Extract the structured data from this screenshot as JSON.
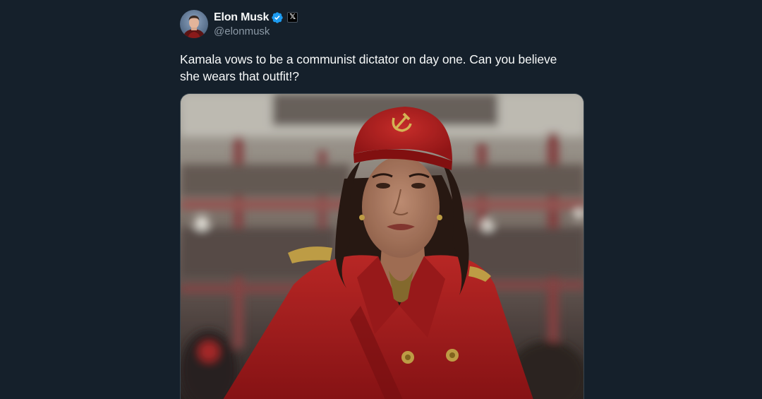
{
  "tweet": {
    "author": {
      "display_name": "Elon Musk",
      "handle": "@elonmusk",
      "verified_icon": "verified-badge-icon",
      "affiliate_icon": "x-logo-icon",
      "affiliate_label": "𝕏"
    },
    "text": "Kamala vows to be a communist dictator on day one. Can you believe she wears that outfit!?",
    "media": {
      "alt": "Image of a woman in a red military-style coat and red cap with hammer and sickle emblem"
    }
  },
  "colors": {
    "background": "#15202b",
    "text_primary": "#f7f9f9",
    "text_secondary": "#8b98a5",
    "verified_blue": "#1d9bf0",
    "coat_red": "#b01c1e"
  }
}
